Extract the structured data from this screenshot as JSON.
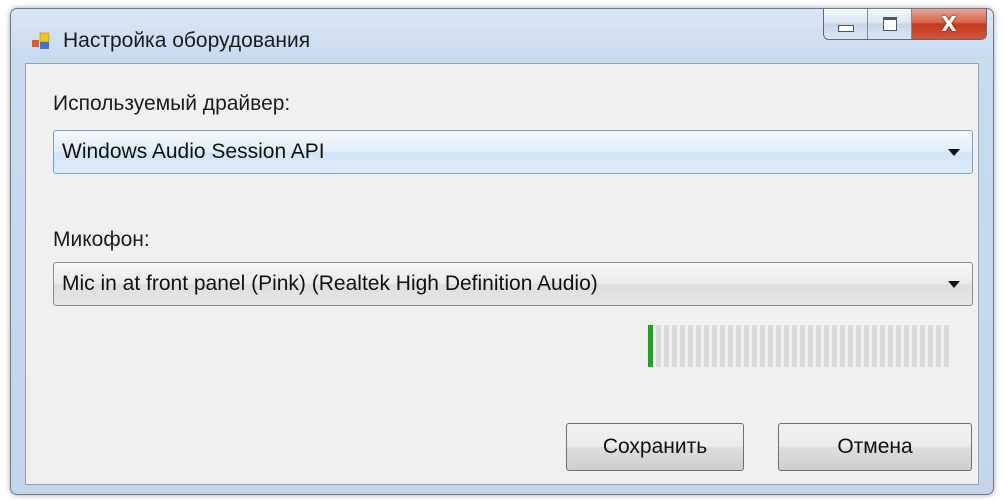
{
  "window": {
    "title": "Настройка оборудования",
    "close_symbol": "X"
  },
  "driver": {
    "label": "Используемый драйвер:",
    "selected": "Windows Audio Session API"
  },
  "microphone": {
    "label": "Микофон:",
    "selected": "Mic in at front panel (Pink) (Realtek High Definition Audio)"
  },
  "level_meter": {
    "segments_total": 38,
    "segments_active": 1,
    "active_color": "#1da41d",
    "inactive_color": "#dadada"
  },
  "buttons": {
    "save_label": "Сохранить",
    "cancel_label": "Отмена"
  },
  "icons": {
    "app": "window-app-icon",
    "minimize": "minimize-icon",
    "maximize": "maximize-icon",
    "close": "close-icon",
    "dropdown": "chevron-down-icon"
  }
}
